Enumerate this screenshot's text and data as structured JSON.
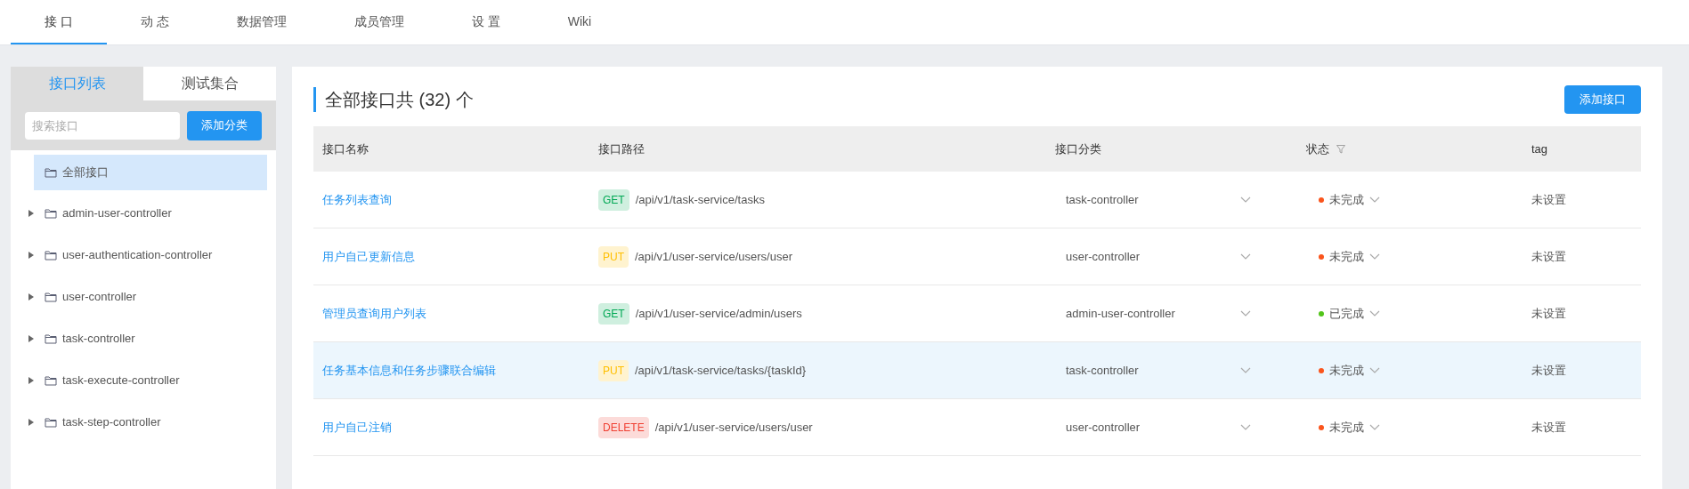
{
  "nav": {
    "tabs": [
      {
        "label": "接 口",
        "selected": true
      },
      {
        "label": "动 态",
        "selected": false
      },
      {
        "label": "数据管理",
        "selected": false
      },
      {
        "label": "成员管理",
        "selected": false
      },
      {
        "label": "设 置",
        "selected": false
      },
      {
        "label": "Wiki",
        "selected": false
      }
    ]
  },
  "sidebar": {
    "tabs": [
      {
        "label": "接口列表",
        "selected": true
      },
      {
        "label": "测试集合",
        "selected": false
      }
    ],
    "search": {
      "placeholder": "搜索接口"
    },
    "add_button": "添加分类",
    "tree": [
      {
        "label": "全部接口",
        "selected": true,
        "expandable": false
      },
      {
        "label": "admin-user-controller",
        "selected": false,
        "expandable": true
      },
      {
        "label": "user-authentication-controller",
        "selected": false,
        "expandable": true
      },
      {
        "label": "user-controller",
        "selected": false,
        "expandable": true
      },
      {
        "label": "task-controller",
        "selected": false,
        "expandable": true
      },
      {
        "label": "task-execute-controller",
        "selected": false,
        "expandable": true
      },
      {
        "label": "task-step-controller",
        "selected": false,
        "expandable": true
      }
    ]
  },
  "main": {
    "title": "全部接口共 (32) 个",
    "add_button": "添加接口",
    "table": {
      "columns": [
        "接口名称",
        "接口路径",
        "接口分类",
        "状态",
        "tag"
      ],
      "rows": [
        {
          "name": "任务列表查询",
          "method": "GET",
          "kind": "get",
          "path": "/api/v1/task-service/tasks",
          "category": "task-controller",
          "status": "未完成",
          "color": "#fa541c",
          "tag": "未设置",
          "selected": false
        },
        {
          "name": "用户自己更新信息",
          "method": "PUT",
          "kind": "put",
          "path": "/api/v1/user-service/users/user",
          "category": "user-controller",
          "status": "未完成",
          "color": "#fa541c",
          "tag": "未设置",
          "selected": false
        },
        {
          "name": "管理员查询用户列表",
          "method": "GET",
          "kind": "get",
          "path": "/api/v1/user-service/admin/users",
          "category": "admin-user-controller",
          "status": "已完成",
          "color": "#52c41a",
          "tag": "未设置",
          "selected": false
        },
        {
          "name": "任务基本信息和任务步骤联合编辑",
          "method": "PUT",
          "kind": "put",
          "path": "/api/v1/task-service/tasks/{taskId}",
          "category": "task-controller",
          "status": "未完成",
          "color": "#fa541c",
          "tag": "未设置",
          "selected": true
        },
        {
          "name": "用户自己注销",
          "method": "DELETE",
          "kind": "delete",
          "path": "/api/v1/user-service/users/user",
          "category": "user-controller",
          "status": "未完成",
          "color": "#fa541c",
          "tag": "未设置",
          "selected": false
        }
      ]
    }
  }
}
